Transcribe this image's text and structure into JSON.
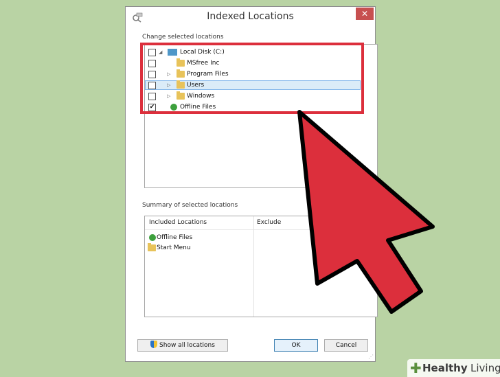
{
  "window": {
    "title": "Indexed Locations",
    "close": "✕"
  },
  "change_section": {
    "label": "Change selected locations",
    "items": [
      {
        "label": "Local Disk (C:)",
        "checked": false,
        "expanded": true,
        "icon": "drive-icon"
      },
      {
        "label": "MSfree Inc",
        "checked": false,
        "icon": "folder-icon"
      },
      {
        "label": "Program Files",
        "checked": false,
        "collapsed": true,
        "icon": "folder-icon"
      },
      {
        "label": "Users",
        "checked": false,
        "collapsed": true,
        "selected": true,
        "icon": "folder-icon"
      },
      {
        "label": "Windows",
        "checked": false,
        "collapsed": true,
        "icon": "folder-icon"
      },
      {
        "label": "Offline Files",
        "checked": true,
        "icon": "sync-icon"
      }
    ],
    "check_mark": "✔"
  },
  "summary_section": {
    "label": "Summary of selected locations",
    "col_included": "Included Locations",
    "col_exclude": "Exclude",
    "included": [
      {
        "label": "Offline Files",
        "icon": "sync-icon"
      },
      {
        "label": "Start Menu",
        "icon": "folder-icon"
      }
    ]
  },
  "buttons": {
    "show_all": "Show all locations",
    "ok": "OK",
    "cancel": "Cancel"
  },
  "overlay": {
    "highlight_color": "#dc2f3c",
    "arrow_color": "#dc2f3c"
  },
  "brand": {
    "part1": "Healthy",
    "part2": "Living",
    "plus": "✚"
  }
}
